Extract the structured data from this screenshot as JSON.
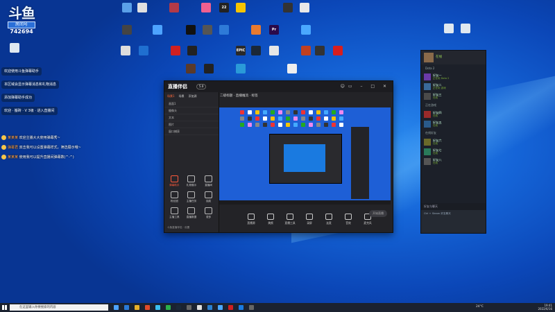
{
  "overlay": {
    "logo_top": "斗鱼",
    "logo_tag": "房间号",
    "room_number": "742694"
  },
  "desktop_icons": [
    {
      "label": "",
      "color": "#5aa0e8"
    },
    {
      "label": "",
      "color": "#e0e0e0"
    },
    {
      "label": "",
      "color": "#b23a48"
    },
    {
      "label": "",
      "color": "#f06090"
    },
    {
      "label": "22",
      "color": "#222"
    },
    {
      "label": "",
      "color": "#f5c400"
    },
    {
      "label": "",
      "color": "#333"
    },
    {
      "label": "",
      "color": "#e8e8e8"
    },
    {
      "label": "",
      "color": "#444"
    },
    {
      "label": "",
      "color": "#4da3ff"
    },
    {
      "label": "",
      "color": "#111"
    },
    {
      "label": "",
      "color": "#555"
    },
    {
      "label": "",
      "color": "#2e7ad8"
    },
    {
      "label": "",
      "color": "#e87a30"
    },
    {
      "label": "Pr",
      "color": "#2a0a4a"
    },
    {
      "label": "",
      "color": "#4aa8ff"
    },
    {
      "label": "",
      "color": "#ddd"
    },
    {
      "label": "",
      "color": "#1f6fd0"
    },
    {
      "label": "",
      "color": "#d02020"
    },
    {
      "label": "",
      "color": "#222"
    },
    {
      "label": "EPIC",
      "color": "#2a2a2a"
    },
    {
      "label": "",
      "color": "#1b2838"
    },
    {
      "label": "",
      "color": "#e6e6e6"
    },
    {
      "label": "",
      "color": "#c04020"
    },
    {
      "label": "",
      "color": "#333"
    },
    {
      "label": "",
      "color": "#d81e1e"
    },
    {
      "label": "",
      "color": "#5a3a2a"
    },
    {
      "label": "",
      "color": "#222"
    },
    {
      "label": "",
      "color": "#2a9ad8"
    },
    {
      "label": "",
      "color": "#eee"
    }
  ],
  "chat_messages": [
    "欢迎使用斗鱼弹幕助手",
    "本区域会显示弹幕消息和礼物消息",
    "添加弹幕助手成功",
    "欢迎 · 搬砖 · V 3级 · 进入直播间"
  ],
  "danmu": [
    {
      "name": "某某某",
      "text": "欢迎主播大大使用弹幕秀~"
    },
    {
      "name": "弹幕君",
      "text": "双击我可以设置弹幕样式，筛选展示哦~"
    },
    {
      "name": "某某某",
      "text": "使用我可以提升直播间弹幕数(^-^)"
    }
  ],
  "obs_window": {
    "brand": "直播伴侣",
    "version": "5.0",
    "tabs": [
      "场景1",
      "场景",
      "添加源"
    ],
    "scenes": [
      "画面1",
      "摄像头",
      "文本",
      "图片",
      "窗口捕获"
    ],
    "header_text": "二级标题  ·  直播推流  ·  标签",
    "tools": [
      {
        "label": "弹幕助手",
        "active": true
      },
      {
        "label": "礼物展示",
        "active": false
      },
      {
        "label": "直播间",
        "active": false
      },
      {
        "label": "粉丝团",
        "active": false
      },
      {
        "label": "主播任务",
        "active": false
      },
      {
        "label": "抽奖",
        "active": false
      },
      {
        "label": "主播工具",
        "active": false
      },
      {
        "label": "直播数据",
        "active": false
      },
      {
        "label": "更多",
        "active": false
      }
    ],
    "sidebar_footer": "斗鱼直播伴侣 · 设置",
    "bottom_controls": [
      "直播源",
      "美颜",
      "直播工具",
      "录屏",
      "连麦",
      "音效",
      "麦克风"
    ],
    "start_label": "开始直播"
  },
  "steam": {
    "username": "在线",
    "sections": [
      "Dota 2",
      "正在游戏",
      "在线好友"
    ],
    "friends": [
      {
        "name": "好友一",
        "status": "正在玩 Dota 2",
        "color": "#6a3aa8"
      },
      {
        "name": "好友二",
        "status": "正在玩 游戏",
        "color": "#3a6a9a"
      },
      {
        "name": "好友三",
        "status": "在线",
        "color": "#4a4a4a"
      },
      {
        "name": "好友四",
        "status": "在线",
        "color": "#9a2a2a"
      },
      {
        "name": "好友五",
        "status": "在线",
        "color": "#2a5a8a"
      },
      {
        "name": "好友六",
        "status": "在线",
        "color": "#6a6a2a"
      },
      {
        "name": "好友七",
        "status": "在线",
        "color": "#2a7a5a"
      },
      {
        "name": "好友八",
        "status": "在线",
        "color": "#555"
      }
    ],
    "chat_title": "好友与聊天",
    "chat_message": "Ctrl + Steam 好友聊天"
  },
  "taskbar": {
    "search_placeholder": "在这里输入你要搜索的内容",
    "temperature": "24°C",
    "time": "19:41",
    "date": "2022/6/16",
    "app_colors": [
      "#4da3ff",
      "#2a7ad8",
      "#e8b02a",
      "#e04a2a",
      "#3ac0f0",
      "#2ab04a",
      "#1b2838",
      "#666",
      "#e0e0e0",
      "#2a80d0",
      "#4aa8ff",
      "#d02020",
      "#1a7ae0",
      "#666"
    ]
  }
}
